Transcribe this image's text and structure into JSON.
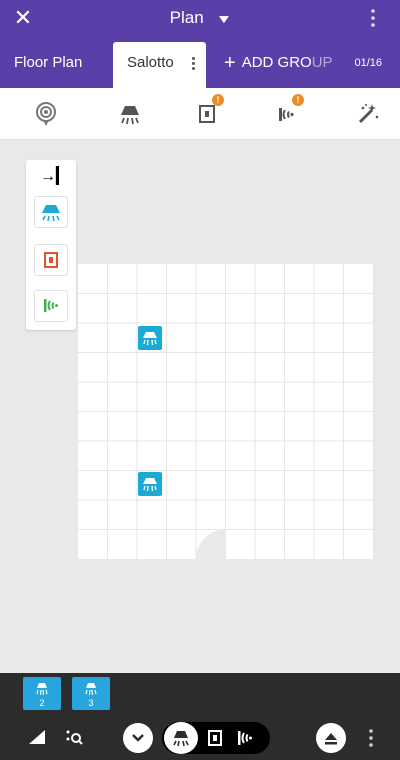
{
  "appbar": {
    "title": "Plan",
    "close_icon": "close-icon",
    "menu_icon": "more-vertical-icon"
  },
  "tabs": {
    "floor_plan": "Floor Plan",
    "active_group": "Salotto",
    "add_group_plus": "+",
    "add_group_prefix": "ADD GRO",
    "add_group_suffix": "UP",
    "page_count": "01/16"
  },
  "toolbar": {
    "icons": [
      "broadcast-pin-icon",
      "ceiling-lamp-icon",
      "panel-icon",
      "beacon-icon",
      "magic-wand-icon"
    ],
    "badges": {
      "panel": "!",
      "beacon": "!"
    }
  },
  "palette": {
    "collapse_icon": "collapse-right-icon",
    "items": [
      "ceiling-lamp-icon",
      "panel-icon",
      "beacon-icon"
    ]
  },
  "grid": {
    "columns": 10,
    "rows": 10
  },
  "tray": {
    "chips": [
      {
        "icon": "ceiling-lamp-icon",
        "count": "2"
      },
      {
        "icon": "ceiling-lamp-icon",
        "count": "3"
      }
    ]
  },
  "bottombar": {
    "icons": [
      "signal-icon",
      "zoom-search-icon",
      "chevron-down-icon",
      "ceiling-lamp-icon",
      "panel-icon",
      "beacon-icon",
      "eject-icon",
      "more-vertical-icon"
    ]
  },
  "colors": {
    "primary": "#5b3fa8",
    "device": "#1ba9d6",
    "badge": "#f08a24",
    "panel": "#e2532d",
    "beacon": "#3cb44a",
    "dark": "#2c2c2c"
  }
}
